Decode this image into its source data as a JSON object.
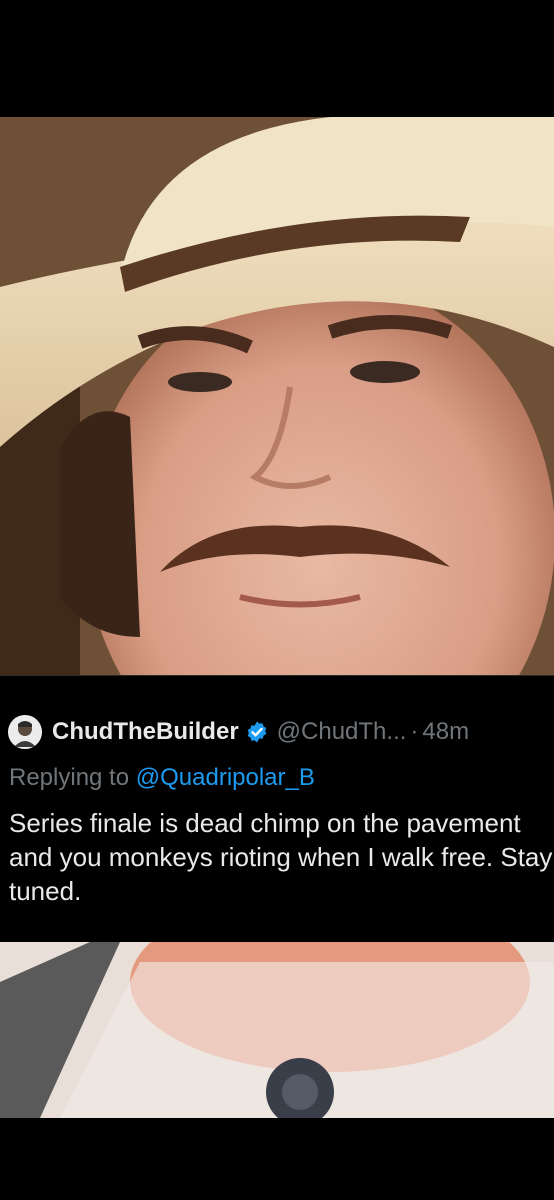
{
  "tweet": {
    "display_name": "ChudTheBuilder",
    "handle": "@ChudTh...",
    "separator": "·",
    "time": "48m",
    "replying_prefix": "Replying to",
    "replying_to": "@Quadripolar_B",
    "text": "Series finale is dead chimp on the pavement and you monkeys rioting when I walk free. Stay tuned.",
    "verified_icon": "verified-badge-icon",
    "colors": {
      "name": "#e7e9ea",
      "secondary": "#71767b",
      "link": "#1d9bf0",
      "background": "#000000"
    }
  },
  "images": {
    "top_photo": "man-with-cowboy-hat-and-mustache",
    "bottom_photo": "man-wearing-white-shirt-with-microphone"
  }
}
